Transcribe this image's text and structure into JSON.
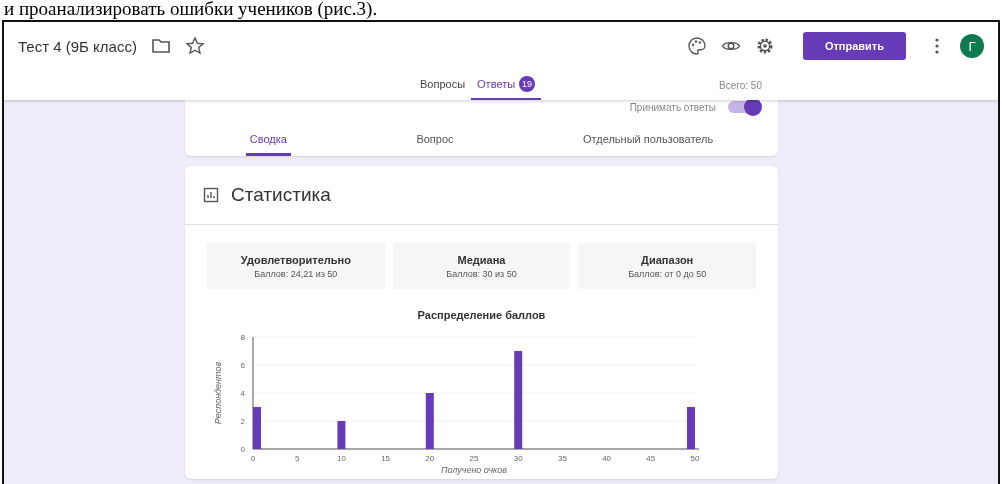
{
  "document_text": "и проанализировать ошибки учеников (рис.3).",
  "window": {
    "title": "Тест 4 (9Б класс)"
  },
  "send_button": "Отправить",
  "avatar": "Г",
  "tabs": [
    {
      "label": "Вопросы",
      "selected": false
    },
    {
      "label": "Ответы",
      "selected": true,
      "badge": "19"
    }
  ],
  "total": "Всего: 50",
  "accept_responses": {
    "label": "Принимать ответы",
    "on": true
  },
  "subtabs": [
    {
      "label": "Сводка",
      "selected": true
    },
    {
      "label": "Вопрос",
      "selected": false
    },
    {
      "label": "Отдельный пользователь",
      "selected": false
    }
  ],
  "stats": {
    "title": "Статистика",
    "cards": [
      {
        "title": "Удовлетворительно",
        "value": "Баллов: 24,21 из 50"
      },
      {
        "title": "Медиана",
        "value": "Баллов: 30 из 50"
      },
      {
        "title": "Диапазон",
        "value": "Баллов: от 0 до 50"
      }
    ],
    "chart_data": {
      "type": "bar",
      "title": "Распределение баллов",
      "xlabel": "Получено очков",
      "ylabel": "Респондентов",
      "x": [
        0,
        10,
        20,
        30,
        50
      ],
      "series": [
        {
          "color": "#673ab7",
          "values": [
            3,
            2,
            4,
            7,
            3
          ]
        }
      ],
      "grid": true,
      "xlim": [
        0,
        50
      ],
      "ylim": [
        0,
        8
      ],
      "xticks": [
        0,
        5,
        10,
        15,
        20,
        25,
        30,
        35,
        40,
        45,
        50
      ],
      "yticks": [
        0,
        2,
        4,
        6,
        8
      ]
    }
  }
}
